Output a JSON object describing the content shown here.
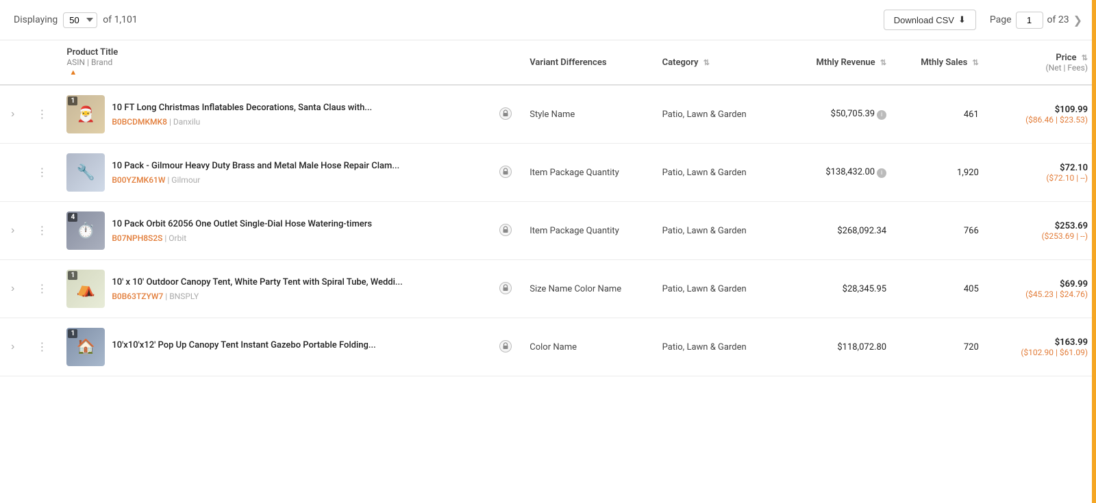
{
  "topBar": {
    "displaying_label": "Displaying",
    "per_page": "50",
    "of_label": "of",
    "total_items": "1,101",
    "download_csv_label": "Download CSV",
    "page_label": "Page",
    "current_page": "1",
    "of_pages_label": "of 23"
  },
  "table": {
    "columns": [
      {
        "key": "expand",
        "label": "",
        "sub": ""
      },
      {
        "key": "menu",
        "label": "",
        "sub": ""
      },
      {
        "key": "product",
        "label": "Product Title",
        "sub": "ASIN | Brand",
        "sortable": true,
        "sort_state": "asc"
      },
      {
        "key": "lock",
        "label": "",
        "sub": ""
      },
      {
        "key": "variant",
        "label": "Variant Differences",
        "sub": "",
        "sortable": false
      },
      {
        "key": "category",
        "label": "Category",
        "sub": "",
        "sortable": true
      },
      {
        "key": "revenue",
        "label": "Mthly Revenue",
        "sub": "",
        "sortable": true
      },
      {
        "key": "sales",
        "label": "Mthly Sales",
        "sub": "",
        "sortable": true
      },
      {
        "key": "price",
        "label": "Price",
        "sub": "(Net | Fees)",
        "sortable": true
      }
    ],
    "rows": [
      {
        "id": 1,
        "has_expand": true,
        "badge": "1",
        "thumb_class": "thumb-1",
        "thumb_emoji": "🎅",
        "title": "10 FT Long Christmas Inflatables Decorations, Santa Claus with...",
        "asin": "B0BCDMKMK8",
        "brand": "Danxilu",
        "lock": true,
        "variant": "Style Name",
        "category": "Patio, Lawn & Garden",
        "revenue": "$50,705.39",
        "revenue_info": true,
        "sales": "461",
        "price_main": "$109.99",
        "price_sub": "($86.46 | $23.53)"
      },
      {
        "id": 2,
        "has_expand": false,
        "badge": "",
        "thumb_class": "thumb-2",
        "thumb_emoji": "🔧",
        "title": "10 Pack - Gilmour Heavy Duty Brass and Metal Male Hose Repair Clam...",
        "asin": "B00YZMK61W",
        "brand": "Gilmour",
        "lock": true,
        "variant": "Item Package Quantity",
        "category": "Patio, Lawn & Garden",
        "revenue": "$138,432.00",
        "revenue_info": true,
        "sales": "1,920",
        "price_main": "$72.10",
        "price_sub": "($72.10 | --)"
      },
      {
        "id": 3,
        "has_expand": true,
        "badge": "4",
        "thumb_class": "thumb-3",
        "thumb_emoji": "⏱️",
        "title": "10 Pack Orbit 62056 One Outlet Single-Dial Hose Watering-timers",
        "asin": "B07NPH8S2S",
        "brand": "Orbit",
        "lock": true,
        "variant": "Item Package Quantity",
        "category": "Patio, Lawn & Garden",
        "revenue": "$268,092.34",
        "revenue_info": false,
        "sales": "766",
        "price_main": "$253.69",
        "price_sub": "($253.69 | --)"
      },
      {
        "id": 4,
        "has_expand": true,
        "badge": "1",
        "thumb_class": "thumb-4",
        "thumb_emoji": "⛺",
        "title": "10' x 10' Outdoor Canopy Tent, White Party Tent with Spiral Tube, Weddi...",
        "asin": "B0B63TZYW7",
        "brand": "BNSPLY",
        "lock": true,
        "variant": "Size Name Color Name",
        "category": "Patio, Lawn & Garden",
        "revenue": "$28,345.95",
        "revenue_info": false,
        "sales": "405",
        "price_main": "$69.99",
        "price_sub": "($45.23 | $24.76)"
      },
      {
        "id": 5,
        "has_expand": true,
        "badge": "1",
        "thumb_class": "thumb-5",
        "thumb_emoji": "🏠",
        "title": "10'x10'x12' Pop Up Canopy Tent Instant Gazebo Portable Folding...",
        "asin": "",
        "brand": "",
        "lock": true,
        "variant": "Color Name",
        "category": "Patio, Lawn & Garden",
        "revenue": "$118,072.80",
        "revenue_info": false,
        "sales": "720",
        "price_main": "$163.99",
        "price_sub": "($102.90 | $61.09)"
      }
    ]
  }
}
